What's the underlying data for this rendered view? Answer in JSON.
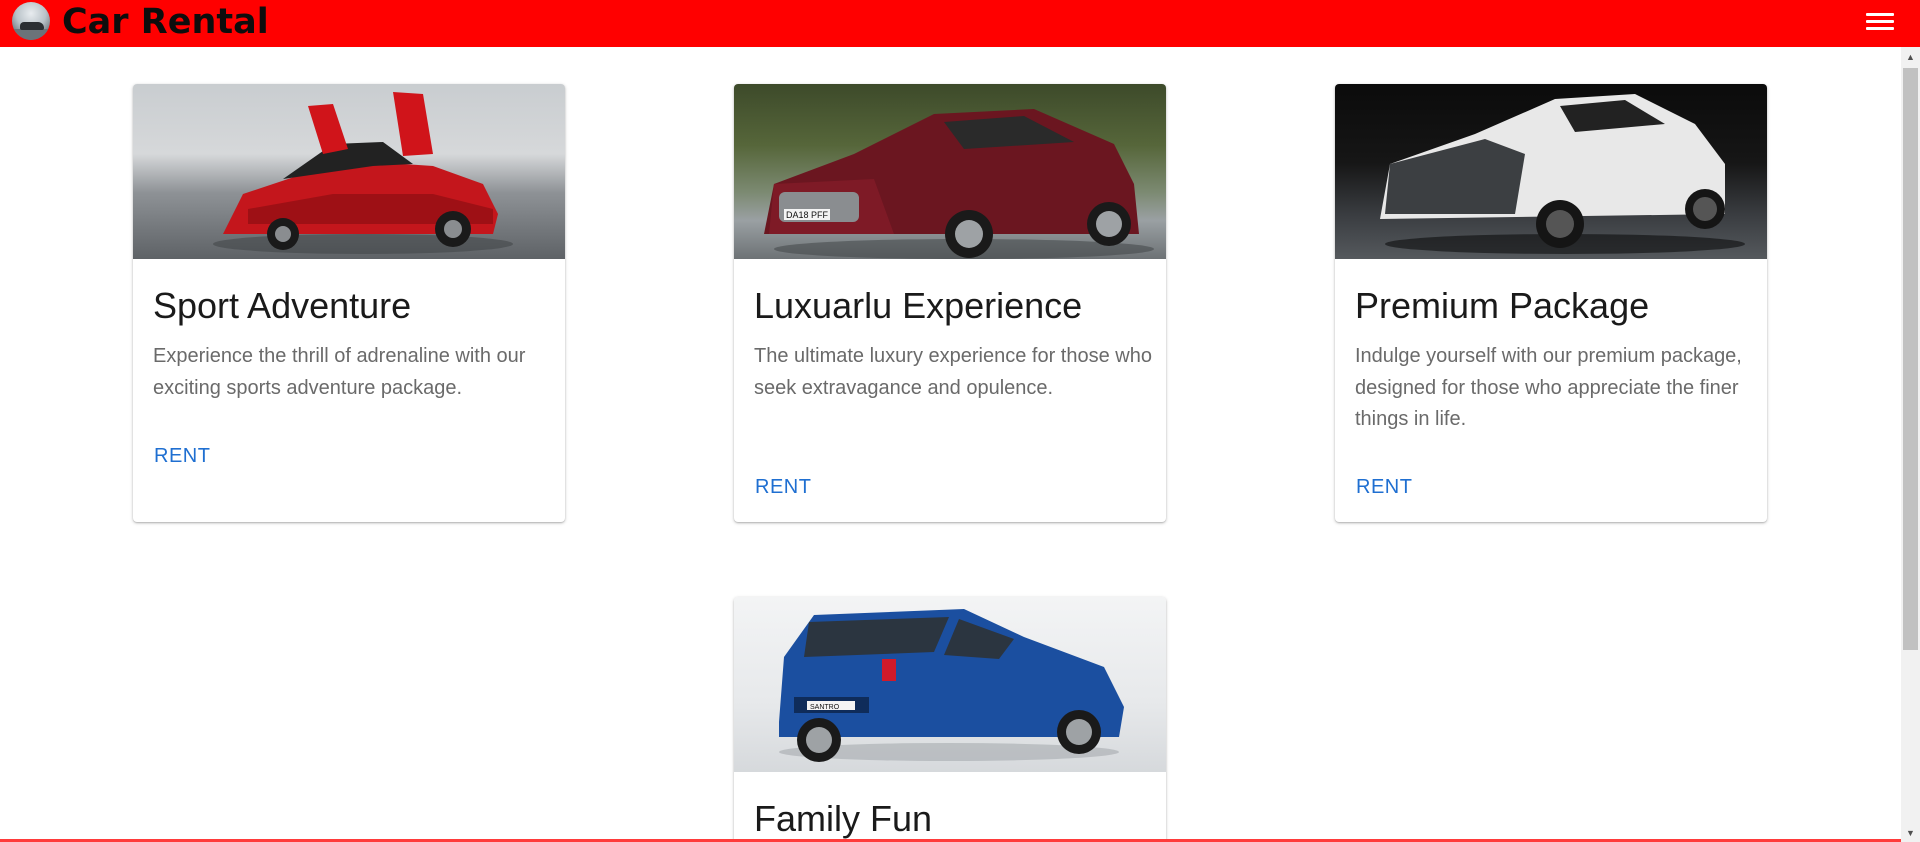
{
  "app": {
    "title": "Car Rental",
    "logo_icon": "car-logo-icon",
    "menu_icon": "hamburger-menu-icon"
  },
  "colors": {
    "header_bg": "#ff0000",
    "link": "#1f6fd1",
    "title_text": "#1a1a1a",
    "desc_text": "#6a6a6a"
  },
  "cards": [
    {
      "title": "Sport Adventure",
      "description": "Experience the thrill of adrenaline with our exciting sports adventure package.",
      "action": "RENT",
      "image_icon": "red-sports-car-image"
    },
    {
      "title": "Luxuarlu Experience",
      "description": "The ultimate luxury experience for those who seek extravagance and opulence.",
      "action": "RENT",
      "image_icon": "maroon-luxury-coupe-image",
      "plate": "DA18 PFF"
    },
    {
      "title": "Premium Package",
      "description": "Indulge yourself with our premium package, designed for those who appreciate the finer things in life.",
      "action": "RENT",
      "image_icon": "white-premium-coupe-image"
    },
    {
      "title": "Family Fun",
      "image_icon": "blue-hatchback-image",
      "badge": "SANTRO"
    }
  ]
}
